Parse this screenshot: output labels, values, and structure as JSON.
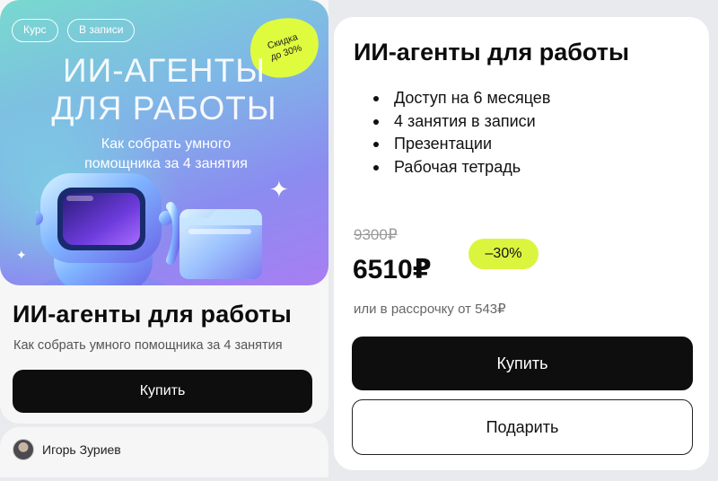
{
  "course_card": {
    "hero": {
      "chips": [
        "Курс",
        "В записи"
      ],
      "sticker_line1": "Скидка",
      "sticker_line2": "до 30%",
      "title_line1": "ИИ-АГЕНТЫ",
      "title_line2": "ДЛЯ РАБОТЫ",
      "subtitle": "Как собрать умного помощника за 4 занятия"
    },
    "title": "ИИ-агенты для работы",
    "subtitle": "Как собрать умного помощника за 4 занятия",
    "buy_label": "Купить"
  },
  "author": {
    "name": "Игорь Зуриев"
  },
  "offer": {
    "title": "ИИ-агенты для работы",
    "features": [
      "Доступ на 6 месяцев",
      "4 занятия в записи",
      "Презентации",
      "Рабочая тетрадь"
    ],
    "old_price": "9300₽",
    "new_price": "6510₽",
    "discount": "–30%",
    "installment": "или в рассрочку от 543₽",
    "buy_label": "Купить",
    "gift_label": "Подарить"
  },
  "colors": {
    "accent_lime": "#dbf53f",
    "button_dark": "#0e0e0f",
    "page_bg": "#e9eaee"
  }
}
